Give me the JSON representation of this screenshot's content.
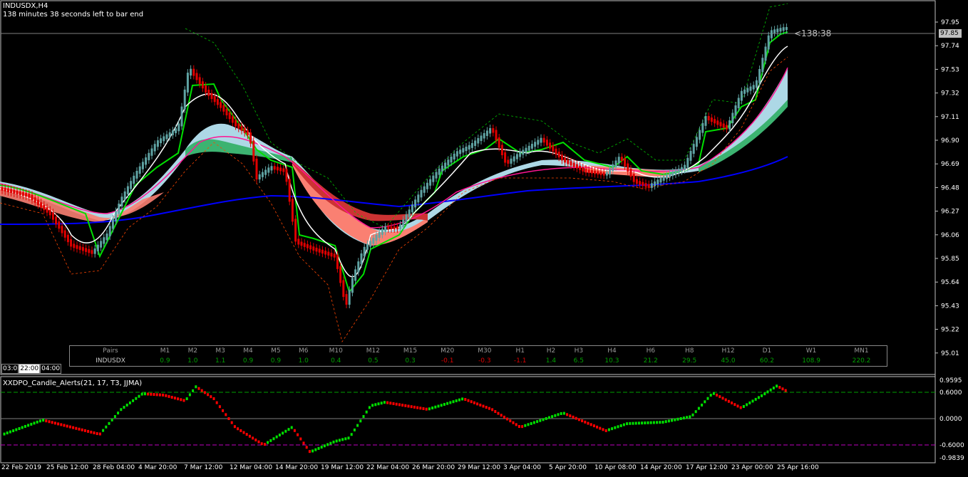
{
  "header": {
    "symbol": "INDUSDX,H4",
    "bar_timer_text": "138 minutes 38 seconds left to bar end"
  },
  "current_price": "97.85",
  "timer_label": "<138:38",
  "price_axis": [
    "97.95",
    "97.74",
    "97.53",
    "97.32",
    "97.11",
    "96.90",
    "96.69",
    "96.48",
    "96.27",
    "96.06",
    "95.85",
    "95.64",
    "95.43",
    "95.22",
    "95.01"
  ],
  "indicator": {
    "title": "XXDPO_Candle_Alerts(21, 17, T3, JJMA)",
    "axis": [
      "0.9595",
      "0.6000",
      "0.0000",
      "-0.6000",
      "-0.9839"
    ]
  },
  "datetime_box": [
    "03:0",
    "22:00",
    "04:00"
  ],
  "pairs_table": {
    "header": [
      "Pairs",
      "M1",
      "M2",
      "M3",
      "M4",
      "M5",
      "M6",
      "M10",
      "M12",
      "M15",
      "M20",
      "M30",
      "H1",
      "H2",
      "H3",
      "H4",
      "H6",
      "H8",
      "H12",
      "D1",
      "W1",
      "MN1"
    ],
    "row": [
      "INDUSDX",
      "0.9",
      "1.0",
      "1.1",
      "0.9",
      "0.9",
      "1.0",
      "0.4",
      "0.5",
      "0.3",
      "-0.1",
      "-0.3",
      "-1.1",
      "1.4",
      "6.5",
      "10.3",
      "21.2",
      "29.5",
      "45.0",
      "60.2",
      "108.9",
      "220.2"
    ],
    "colors": {
      "positive": "#00a000",
      "negative": "#e00000",
      "neutral": "#999999"
    }
  },
  "time_axis": [
    "22 Feb 2019",
    "25 Feb 12:00",
    "28 Feb 04:00",
    "4 Mar 20:00",
    "7 Mar 12:00",
    "12 Mar 04:00",
    "14 Mar 20:00",
    "19 Mar 12:00",
    "22 Mar 04:00",
    "26 Mar 20:00",
    "29 Mar 12:00",
    "3 Apr 04:00",
    "5 Apr 20:00",
    "10 Apr 08:00",
    "14 Apr 20:00",
    "17 Apr 12:00",
    "23 Apr 00:00",
    "25 Apr 16:00"
  ],
  "colors": {
    "bull": "#5fa3a3",
    "bear": "#e00000",
    "ma_blue": "#0000ff",
    "osc_up": "#00e000",
    "osc_down": "#ff0000",
    "level_line": "#00a000",
    "neg_level": "#c000c0",
    "cloud_up": "#add8e6",
    "cloud_down": "#fa8072",
    "grid": "#808080"
  }
}
